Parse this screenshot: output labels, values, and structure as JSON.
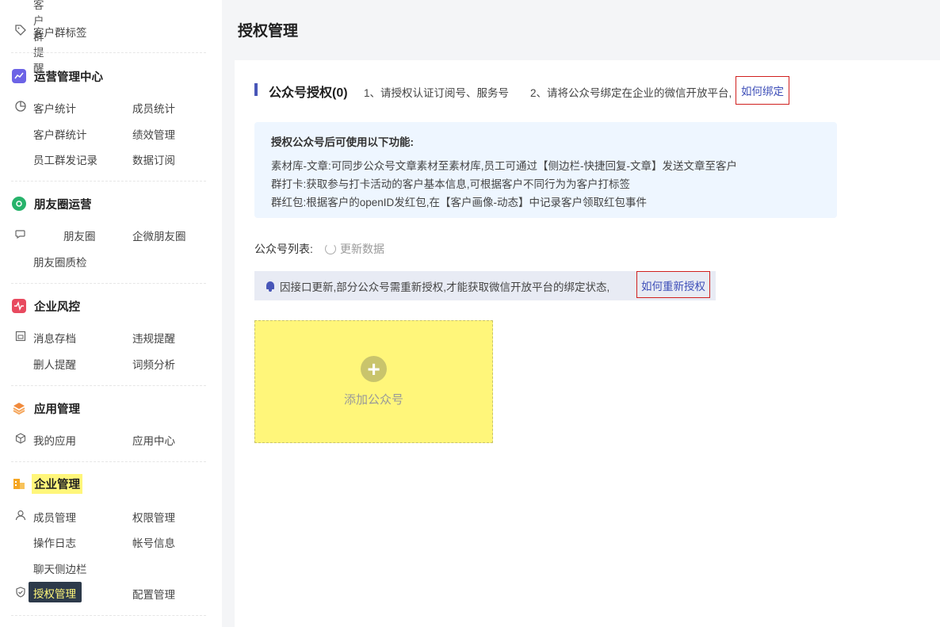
{
  "sidebar": {
    "top_item": "客户群提醒",
    "tag_item": "客户群标签",
    "sections": {
      "ops": {
        "title": "运营管理中心",
        "rows": [
          [
            "客户统计",
            "成员统计"
          ],
          [
            "客户群统计",
            "绩效管理"
          ],
          [
            "员工群发记录",
            "数据订阅"
          ]
        ]
      },
      "moments": {
        "title": "朋友圈运营",
        "rows": [
          [
            "朋友圈",
            "企微朋友圈"
          ],
          [
            "朋友圈质检",
            ""
          ]
        ]
      },
      "risk": {
        "title": "企业风控",
        "rows": [
          [
            "消息存档",
            "违规提醒"
          ],
          [
            "删人提醒",
            "词频分析"
          ]
        ]
      },
      "apps": {
        "title": "应用管理",
        "rows": [
          [
            "我的应用",
            "应用中心"
          ]
        ]
      },
      "enterprise": {
        "title": "企业管理",
        "rows": [
          [
            "成员管理",
            "权限管理"
          ],
          [
            "操作日志",
            "帐号信息"
          ],
          [
            "聊天侧边栏",
            ""
          ],
          [
            "授权管理",
            "配置管理"
          ]
        ]
      }
    },
    "colors": {
      "ops": "#6c63e6",
      "moments": "#27b36b",
      "risk": "#e84a5f",
      "apps": "#f08a3c",
      "enterprise": "#f5a623"
    }
  },
  "page": {
    "title": "授权管理",
    "section_title": "公众号授权(0)",
    "tip1": "1、请授权认证订阅号、服务号",
    "tip2": "2、请将公众号绑定在企业的微信开放平台,",
    "tip2_link": "如何绑定",
    "info": {
      "title": "授权公众号后可使用以下功能:",
      "lines": [
        "素材库-文章:可同步公众号文章素材至素材库,员工可通过【侧边栏-快捷回复-文章】发送文章至客户",
        "群打卡:获取参与打卡活动的客户基本信息,可根据客户不同行为为客户打标签",
        "群红包:根据客户的openID发红包,在【客户画像-动态】中记录客户领取红包事件"
      ]
    },
    "list_label": "公众号列表:",
    "refresh_label": "更新数据",
    "notice_text": "因接口更新,部分公众号需重新授权,才能获取微信开放平台的绑定状态,",
    "notice_link": "如何重新授权",
    "add_label": "添加公众号"
  }
}
